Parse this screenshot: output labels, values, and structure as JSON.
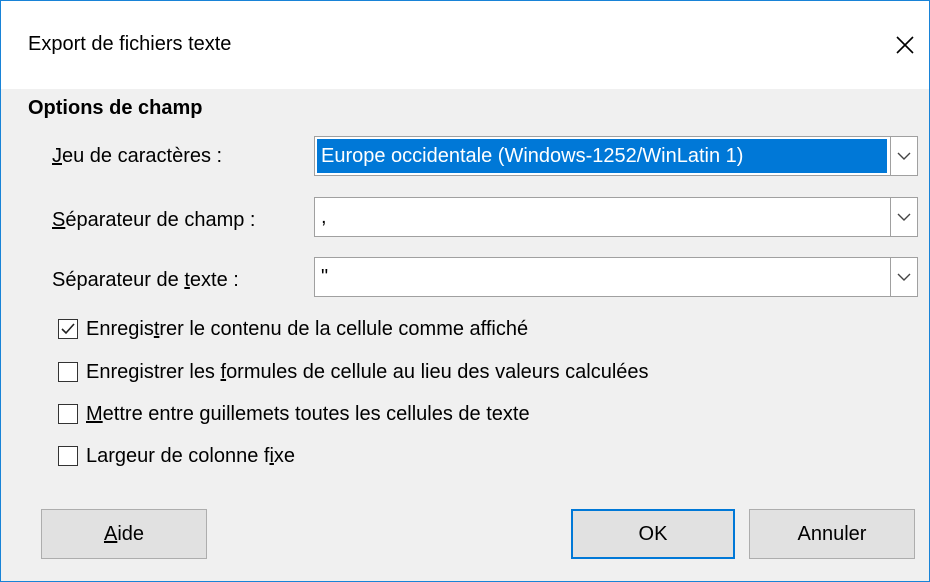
{
  "window": {
    "title": "Export de fichiers texte"
  },
  "section": {
    "title": "Options de champ"
  },
  "fields": [
    {
      "label_pre": "",
      "label_key": "J",
      "label_post": "eu de caractères :",
      "value": "Europe occidentale (Windows-1252/WinLatin 1)",
      "selected": true
    },
    {
      "label_pre": "",
      "label_key": "S",
      "label_post": "éparateur de champ :",
      "value": ","
    },
    {
      "label_pre": "Séparateur de ",
      "label_key": "t",
      "label_post": "exte :",
      "value": "\""
    }
  ],
  "checkboxes": [
    {
      "label_pre": "Enregis",
      "label_key": "t",
      "label_post": "rer le contenu de la cellule comme affiché",
      "checked": true
    },
    {
      "label_pre": "Enregistrer les ",
      "label_key": "f",
      "label_post": "ormules de cellule au lieu des valeurs calculées",
      "checked": false
    },
    {
      "label_pre": "",
      "label_key": "M",
      "label_post": "ettre entre guillemets toutes les cellules de texte",
      "checked": false
    },
    {
      "label_pre": "Largeur de colonne f",
      "label_key": "i",
      "label_post": "xe",
      "checked": false
    }
  ],
  "buttons": {
    "help_key": "A",
    "help_rest": "ide",
    "ok": "OK",
    "cancel": "Annuler"
  },
  "icons": {
    "close": "close-icon",
    "dropdown": "chevron-down-icon",
    "check": "checkmark-icon"
  },
  "colors": {
    "accent": "#0078d7",
    "window_border": "#1883d7",
    "background": "#f0f0f0"
  }
}
